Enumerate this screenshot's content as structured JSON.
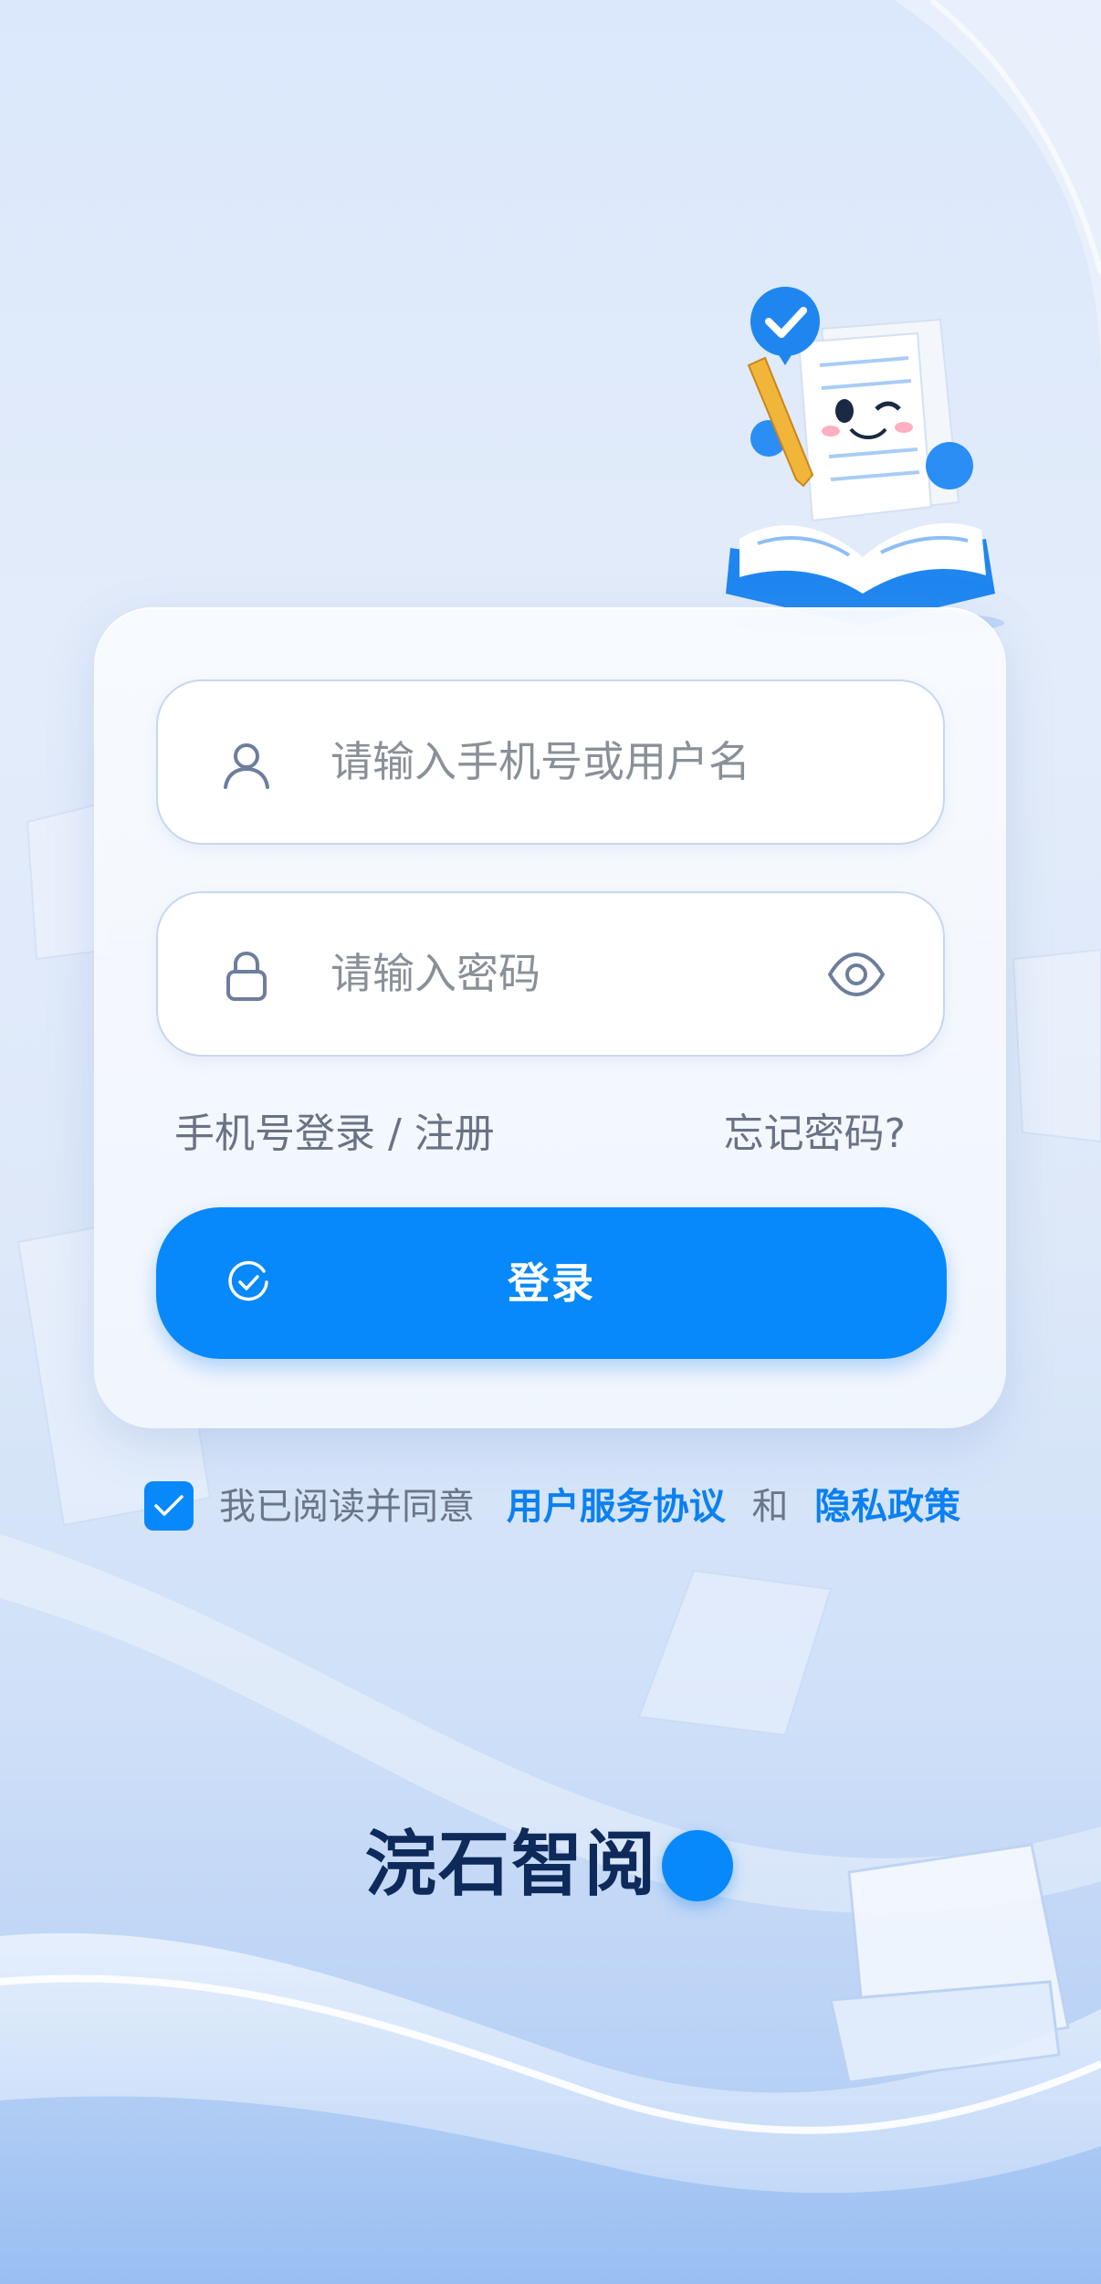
{
  "login": {
    "username_placeholder": "请输入手机号或用户名",
    "password_placeholder": "请输入密码",
    "phone_login_link": "手机号登录 / 注册",
    "forgot_password_link": "忘记密码?",
    "login_button_label": "登录"
  },
  "agreement": {
    "checked": true,
    "prefix": "我已阅读并同意",
    "user_agreement": "用户服务协议",
    "and": "和",
    "privacy_policy": "隐私政策"
  },
  "brand": {
    "name": "浣石智阅"
  },
  "icons": {
    "username": "user-icon",
    "password": "lock-icon",
    "show_password": "eye-icon",
    "login": "check-circle-icon",
    "agreement": "checkmark-icon",
    "mascot": "book-mascot-illustration"
  },
  "colors": {
    "primary": "#0788fb",
    "link": "#0b80f0",
    "brand_text": "#0d2a5a",
    "placeholder": "#8a9097",
    "secondary_text": "#6a7385"
  }
}
